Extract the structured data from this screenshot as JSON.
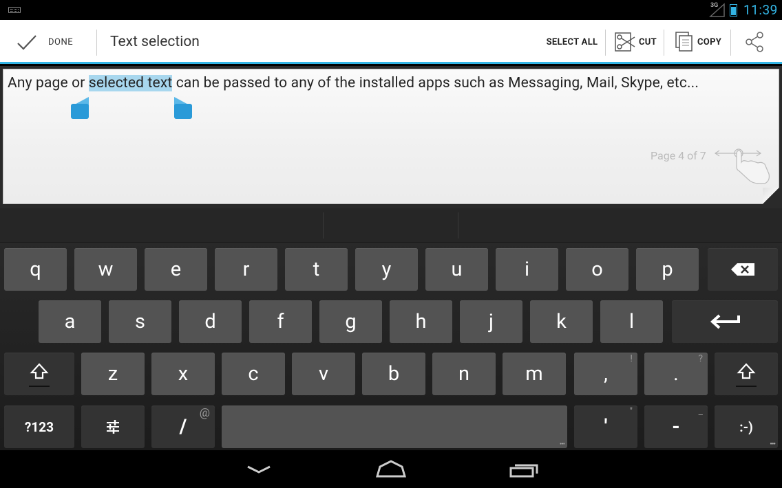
{
  "status_bar": {
    "network": "3G",
    "time": "11:39",
    "accent_color": "#33b5e5"
  },
  "action_bar": {
    "done_label": "DONE",
    "title": "Text selection",
    "select_all_label": "SELECT ALL",
    "cut_label": "CUT",
    "copy_label": "COPY",
    "share_icon": "share-icon"
  },
  "page": {
    "text_before": "Any page or ",
    "text_selected": "selected text",
    "text_after": " can be passed to any of the installed apps such as Messaging, Mail, Skype, etc...",
    "page_indicator": "Page 4 of 7",
    "selection_color": "#a8d7ee"
  },
  "keyboard": {
    "row1": [
      "q",
      "w",
      "e",
      "r",
      "t",
      "y",
      "u",
      "i",
      "o",
      "p"
    ],
    "row2": [
      "a",
      "s",
      "d",
      "f",
      "g",
      "h",
      "j",
      "k",
      "l"
    ],
    "row3": [
      "z",
      "x",
      "c",
      "v",
      "b",
      "n",
      "m",
      ",",
      "."
    ],
    "row3_hints": [
      "",
      "",
      "",
      "",
      "",
      "",
      "",
      "!",
      "?"
    ],
    "symbols_label": "?123",
    "slash_label": "/",
    "slash_hint": "@",
    "apostrophe_label": "'",
    "apostrophe_hint": "\"",
    "dash_label": "-",
    "dash_hint": "_",
    "smiley_label": ":-)",
    "backspace_icon": "backspace-icon",
    "enter_icon": "enter-icon",
    "shift_icon": "shift-icon",
    "settings_icon": "settings-sliders-icon"
  },
  "nav_bar": {
    "back_icon": "back-chevron-icon",
    "home_icon": "home-icon",
    "recents_icon": "recents-icon"
  }
}
